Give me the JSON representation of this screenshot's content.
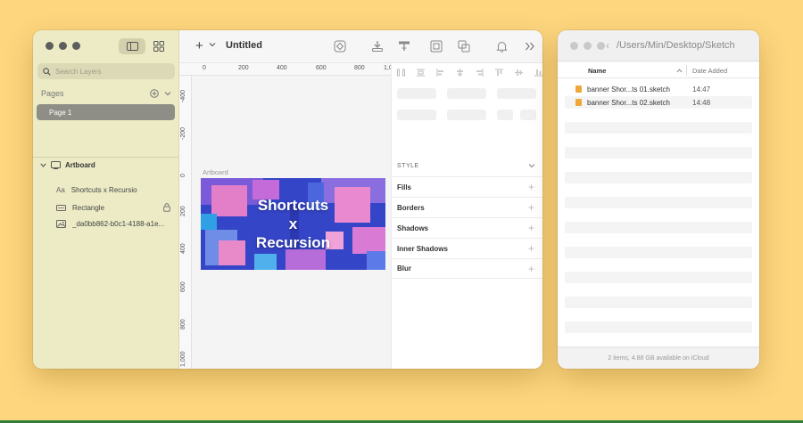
{
  "sketch": {
    "title": "Untitled",
    "search_placeholder": "Search Layers",
    "pages_label": "Pages",
    "pages": [
      {
        "label": "Page 1"
      }
    ],
    "artboard_name": "Artboard",
    "layers": [
      {
        "label": "Shortcuts x Recursio",
        "icon": "text-icon"
      },
      {
        "label": "Rectangle",
        "icon": "rectangle-icon"
      },
      {
        "label": "_da0bb862-b0c1-4188-a1e...",
        "icon": "image-icon"
      }
    ],
    "ruler_top": [
      "0",
      "200",
      "400",
      "600",
      "800",
      "1,0"
    ],
    "ruler_left": [
      "-400",
      "-200",
      "0",
      "200",
      "400",
      "600",
      "800",
      "1,000"
    ],
    "canvas_artboard_label": "Artboard",
    "artboard_text": [
      "Shortcuts",
      "x",
      "Recursion"
    ],
    "inspector": {
      "style_label": "STYLE",
      "rows": [
        "Fills",
        "Borders",
        "Shadows",
        "Inner Shadows",
        "Blur"
      ]
    },
    "toolbar_icons": [
      "symbol-icon",
      "insert-icon",
      "text-style-icon",
      "frame-icon",
      "create-symbol-icon",
      "bell-icon",
      "more-icon"
    ]
  },
  "finder": {
    "path": "/Users/Min/Desktop/Sketch",
    "columns": {
      "name": "Name",
      "date": "Date Added"
    },
    "files": [
      {
        "name": "banner Shor...ts 01.sketch",
        "date": "14:47"
      },
      {
        "name": "banner Shor...ts 02.sketch",
        "date": "14:48"
      }
    ],
    "status": "2 items, 4.88 GB available on iCloud"
  },
  "colors": {
    "desktop": "#fdd67e",
    "sidebar": "#ecebc6",
    "selected_page": "#8e8e86",
    "artboard_blue": "#3b4bd0",
    "artboard_pink": "#e37fc8"
  }
}
